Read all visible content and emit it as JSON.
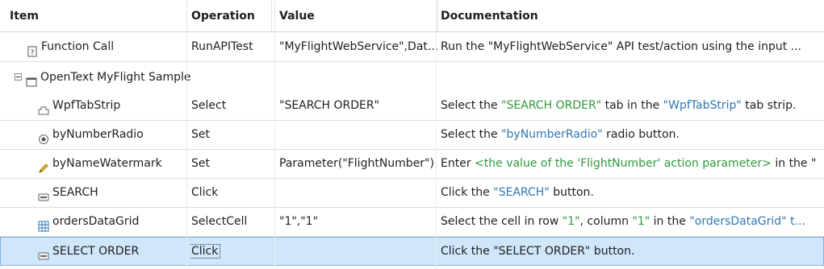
{
  "columns": {
    "item": "Item",
    "operation": "Operation",
    "value": "Value",
    "documentation": "Documentation"
  },
  "rows": [
    {
      "item": "Function Call",
      "icon": "help-document-icon",
      "operation": "RunAPITest",
      "value": "\"MyFlightWebService\",Dat...",
      "doc_plain": "Run the \"MyFlightWebService\" API test/action using the input ..."
    },
    {
      "item": "OpenText MyFlight Sample",
      "icon": "window-icon",
      "operation": "",
      "value": "",
      "doc_plain": ""
    },
    {
      "item": "WpfTabStrip",
      "icon": "tab-strip-icon",
      "operation": "Select",
      "value": "\"SEARCH ORDER\"",
      "doc_prefix": "Select the ",
      "doc_h1": "\"SEARCH ORDER\"",
      "doc_mid": " tab in the ",
      "doc_h2": "\"WpfTabStrip\"",
      "doc_suffix": " tab strip."
    },
    {
      "item": "byNumberRadio",
      "icon": "radio-button-icon",
      "operation": "Set",
      "value": "",
      "doc_prefix": "Select the ",
      "doc_h1": "\"byNumberRadio\"",
      "doc_suffix": " radio button."
    },
    {
      "item": "byNameWatermark",
      "icon": "pencil-edit-icon",
      "operation": "Set",
      "value": "Parameter(\"FlightNumber\")",
      "doc_prefix": "Enter ",
      "doc_h1": "<the value of the 'FlightNumber' action parameter>",
      "doc_suffix": " in the \""
    },
    {
      "item": "SEARCH",
      "icon": "button-icon",
      "operation": "Click",
      "value": "",
      "doc_prefix": "Click the ",
      "doc_h1": "\"SEARCH\"",
      "doc_suffix": " button."
    },
    {
      "item": "ordersDataGrid",
      "icon": "data-grid-icon",
      "operation": "SelectCell",
      "value": "\"1\",\"1\"",
      "doc_prefix": "Select the cell in row ",
      "doc_h1": "\"1\"",
      "doc_mid": ", column ",
      "doc_h2": "\"1\"",
      "doc_mid2": " in the ",
      "doc_h3": "\"ordersDataGrid\" t..."
    },
    {
      "item": "SELECT ORDER",
      "icon": "button-icon",
      "operation": "Click",
      "value": "",
      "doc_plain": "Click the \"SELECT ORDER\" button."
    }
  ],
  "colors": {
    "green_highlight": "#2e9a3a",
    "blue_highlight": "#2f76b3",
    "selected_row": "#cfe6fb"
  }
}
